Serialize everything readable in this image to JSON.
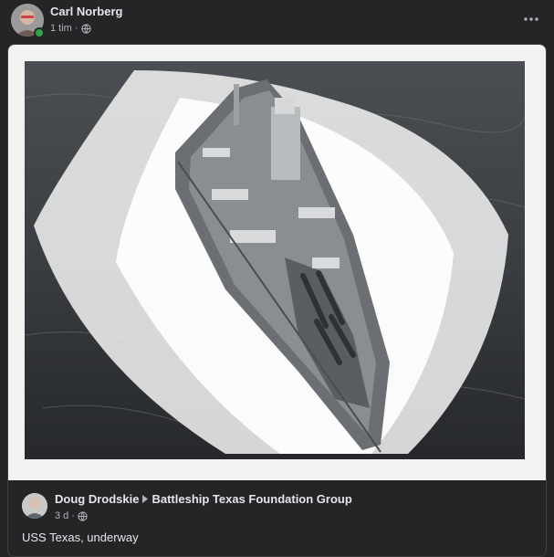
{
  "post": {
    "author": "Carl Norberg",
    "time": "1 tim",
    "separator": "·",
    "audience_icon": "globe-icon",
    "more_icon": "more-dots-icon"
  },
  "shared_post": {
    "author": "Doug Drodskie",
    "arrow_icon": "caret-right-icon",
    "group": "Battleship Texas Foundation Group",
    "time": "3 d",
    "separator": "·",
    "audience_icon": "globe-icon",
    "caption": "USS Texas, underway"
  },
  "colors": {
    "background": "#242526",
    "text_primary": "#e4e6eb",
    "text_secondary": "#b0b3b8",
    "online": "#31a24c"
  }
}
